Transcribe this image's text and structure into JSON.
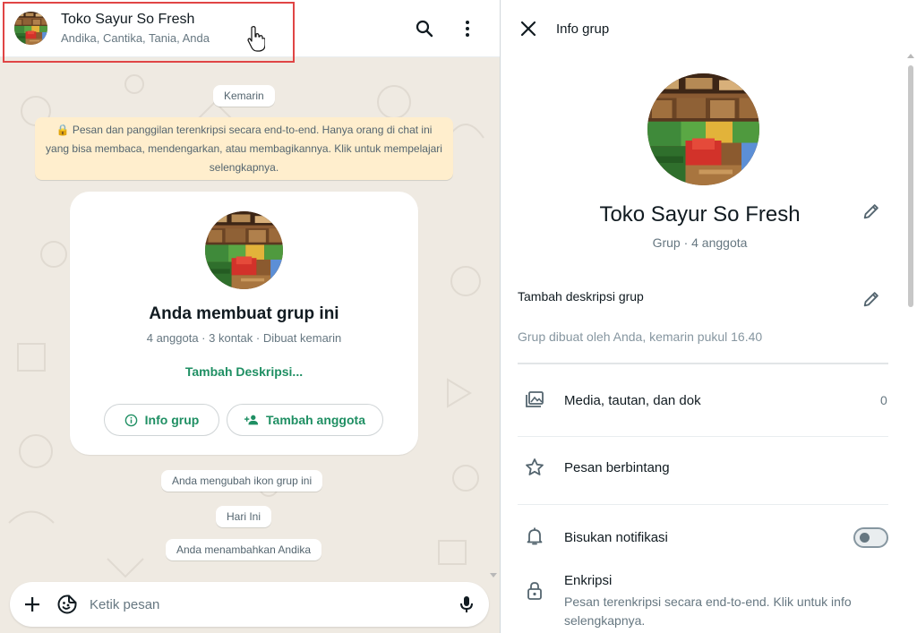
{
  "chat": {
    "title": "Toko Sayur So Fresh",
    "members": "Andika, Cantika, Tania, Anda",
    "date_pill_1": "Kemarin",
    "encryption_notice": "🔒 Pesan dan panggilan terenkripsi secara end-to-end. Hanya orang di chat ini yang bisa membaca, mendengarkan, atau membagikannya. Klik untuk mempelajari selengkapnya.",
    "card": {
      "title": "Anda membuat grup ini",
      "meta": "4 anggota · 3 kontak · Dibuat kemarin",
      "add_description": "Tambah Deskripsi...",
      "info_button": "Info grup",
      "add_member_button": "Tambah anggota"
    },
    "system_msg_1": "Anda mengubah ikon grup ini",
    "date_pill_2": "Hari Ini",
    "system_msg_2": "Anda menambahkan Andika",
    "composer_placeholder": "Ketik pesan"
  },
  "info": {
    "title": "Info grup",
    "group_name": "Toko Sayur So Fresh",
    "group_sub": "Grup · 4 anggota",
    "add_description": "Tambah deskripsi grup",
    "created_by": "Grup dibuat oleh Anda, kemarin pukul 16.40",
    "media_label": "Media, tautan, dan dok",
    "media_count": "0",
    "starred_label": "Pesan berbintang",
    "mute_label": "Bisukan notifikasi",
    "encryption_label": "Enkripsi",
    "encryption_desc": "Pesan terenkripsi secara end-to-end. Klik untuk info selengkapnya."
  },
  "colors": {
    "accent": "#1f8f63",
    "highlight_border": "#e04545",
    "chat_background": "#efeae2",
    "notice_background": "#ffeecd"
  },
  "icons": [
    "search-icon",
    "menu-icon",
    "close-icon",
    "pencil-icon",
    "media-icon",
    "star-icon",
    "bell-icon",
    "lock-icon",
    "plus-icon",
    "sticker-icon",
    "mic-icon",
    "info-icon",
    "add-person-icon"
  ]
}
